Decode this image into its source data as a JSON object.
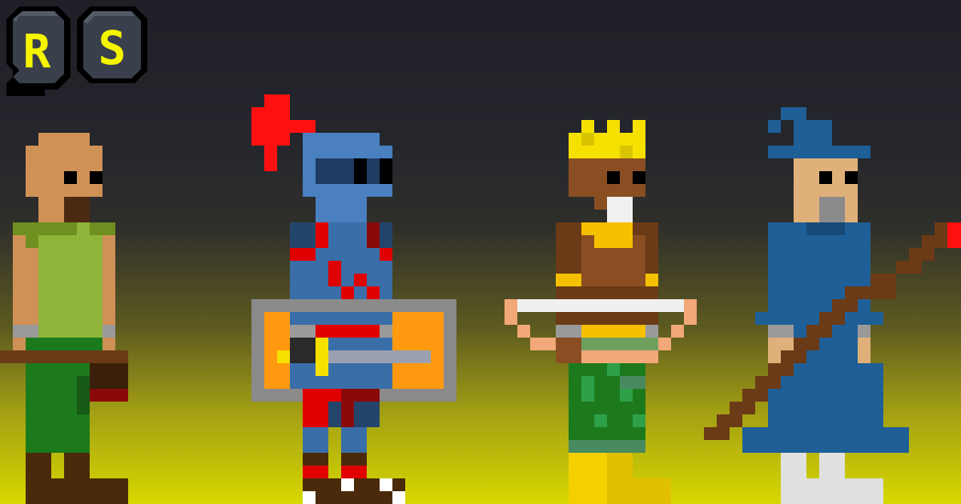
{
  "logo": {
    "text": "RS",
    "letters": [
      "R",
      "S"
    ],
    "stone_color": "#3a3f4c",
    "letter_color": "#f5f500"
  },
  "characters": [
    {
      "id": "peasant",
      "icon": "peasant-character-icon"
    },
    {
      "id": "knight",
      "icon": "knight-character-icon"
    },
    {
      "id": "king",
      "icon": "king-character-icon"
    },
    {
      "id": "wizard",
      "icon": "wizard-character-icon"
    }
  ],
  "colors": {
    "sky_top": "#1f2027",
    "sky_bottom": "#d8d800",
    "knight_plume": "#ff1010",
    "wizard_robe": "#1f5f97",
    "king_crown": "#f5e000"
  }
}
